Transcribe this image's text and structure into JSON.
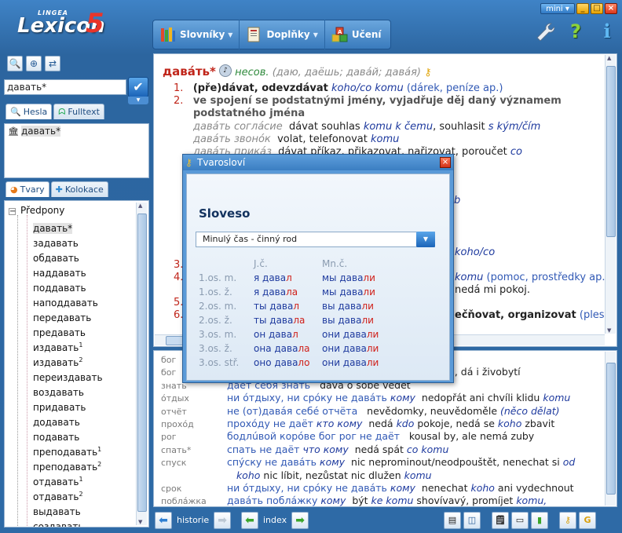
{
  "app": {
    "logo_small": "LINGEA",
    "logo_name": "Lexicon",
    "logo_version": "5",
    "mini_label": "mini",
    "window_buttons": [
      "_",
      "□",
      "×"
    ]
  },
  "menu": {
    "items": [
      {
        "label": "Slovníky",
        "icon": "books-icon",
        "has_dropdown": true
      },
      {
        "label": "Doplňky",
        "icon": "add-ons-icon",
        "has_dropdown": true
      },
      {
        "label": "Učení",
        "icon": "abc-blocks-icon",
        "has_dropdown": false
      }
    ],
    "tools": [
      {
        "icon": "wrench-icon",
        "glyph": "🔧"
      },
      {
        "icon": "help-icon",
        "glyph": "?"
      },
      {
        "icon": "info-icon",
        "glyph": "i"
      }
    ]
  },
  "search": {
    "value": "давать*",
    "go_label": "✔"
  },
  "tabs_top": [
    {
      "label": "Hesla",
      "icon": "magnifier-icon"
    },
    {
      "label": "Fulltext",
      "icon": "binoculars-icon"
    }
  ],
  "hesla_list": [
    {
      "text": "давать*"
    }
  ],
  "tabs_bottom": [
    {
      "label": "Tvary",
      "icon": "pie-icon"
    },
    {
      "label": "Kolokace",
      "icon": "puzzle-icon"
    }
  ],
  "tree": {
    "root": "Předpony",
    "items": [
      {
        "text": "давать*",
        "sup": ""
      },
      {
        "text": "задавать",
        "sup": ""
      },
      {
        "text": "обдавать",
        "sup": ""
      },
      {
        "text": "наддавать",
        "sup": ""
      },
      {
        "text": "поддавать",
        "sup": ""
      },
      {
        "text": "наподдавать",
        "sup": ""
      },
      {
        "text": "передавать",
        "sup": ""
      },
      {
        "text": "предавать",
        "sup": ""
      },
      {
        "text": "издавать",
        "sup": "1"
      },
      {
        "text": "издавать",
        "sup": "2"
      },
      {
        "text": "переиздавать",
        "sup": ""
      },
      {
        "text": "воздавать",
        "sup": ""
      },
      {
        "text": "придавать",
        "sup": ""
      },
      {
        "text": "додавать",
        "sup": ""
      },
      {
        "text": "подавать",
        "sup": ""
      },
      {
        "text": "преподавать",
        "sup": "1"
      },
      {
        "text": "преподавать",
        "sup": "2"
      },
      {
        "text": "отдавать",
        "sup": "1"
      },
      {
        "text": "отдавать",
        "sup": "2"
      },
      {
        "text": "выдавать",
        "sup": ""
      },
      {
        "text": "создавать",
        "sup": ""
      }
    ]
  },
  "entry": {
    "headword": "давáть*",
    "aspect": "несов.",
    "forms": "(даю, даёшь; давáй; давáя)",
    "senses": [
      {
        "num": "1.",
        "bold": "(pře)dávat, odevzdávat",
        "obj": "koho/co komu",
        "note": "(dárek, peníze ap.)"
      },
      {
        "num": "2.",
        "bold": "ve spojení se podstatnými jmény, vyjadřuje děj daný významem",
        "bold2": "podstatného jména"
      }
    ],
    "examples": [
      {
        "ru": "давáть соглáсие",
        "cz": "dávat souhlas",
        "obj": "komu k čemu",
        "cz2": ", souhlasit",
        "obj2": "s kým/čím"
      },
      {
        "ru": "давáть звонóк",
        "cz": "volat, telefonovat",
        "obj": "komu",
        "cz2": "",
        "obj2": ""
      },
      {
        "ru": "давáть прикáз",
        "cz": "dávat příkaz, přikazovat, nařizovat, poroučet",
        "obj": "co",
        "cz2": "",
        "obj2": ""
      }
    ],
    "right_fragments": [
      {
        "text": "koho/co"
      },
      {
        "text": "komu",
        "rest": " (pomoc, prostředky ap.)"
      },
      {
        "text": "nedá mi pokoj."
      },
      {
        "text": "ečňovat, organizovat",
        "rest": " (ples,"
      }
    ],
    "hidden_nums": [
      "3.",
      "4.",
      "5.",
      "6."
    ],
    "hidden_partial": [
      "b"
    ]
  },
  "collocations": [
    {
      "key": "бог",
      "ru": "",
      "cz": ""
    },
    {
      "key": "бог",
      "ru": "",
      "cz": "n, dá i živobytí"
    },
    {
      "key": "знать",
      "ru": "даёт себя знать",
      "cz": "dává o sobě vědět"
    },
    {
      "key": "óтдых",
      "ru": "ни óтдыху, ни срóку не давáть",
      "ru_obj": "кому",
      "cz": "nedopřát ani chvíli klidu",
      "cz_obj": "komu"
    },
    {
      "key": "отчёт",
      "ru": "не (от)давáя себé отчёта",
      "cz": "nevědomky, neuvědoměle",
      "cz_obj": "(něco dělat)"
    },
    {
      "key": "прохóд",
      "ru": "прохóду не даёт",
      "ru_obj": "кто кому",
      "cz": "nedá",
      "cz_obj": "kdo",
      "cz_rest": "pokoje, nedá se",
      "cz_obj2": "koho",
      "cz_rest2": "zbavit"
    },
    {
      "key": "рог",
      "ru": "бодлúвой корóве бог рог не даёт",
      "cz": "kousal by, ale nemá zuby"
    },
    {
      "key": "спать*",
      "ru": "спать не даёт",
      "ru_obj": "что кому",
      "cz": "nedá spát",
      "cz_obj": "co komu"
    },
    {
      "key": "спуск",
      "ru": "спýску не давáть",
      "ru_obj": "кому",
      "cz": "nic neprominout/neodpouštět, nenechat si",
      "cz_obj": "od"
    },
    {
      "key": "",
      "ru": "",
      "cz": "",
      "cz_obj": "koho",
      "cz_rest": "nic líbit, nezůstat nic dlužen",
      "cz_obj2": "komu"
    },
    {
      "key": "срок",
      "ru": "ни óтдыху, ни срóку не давáть",
      "ru_obj": "кому",
      "cz": "nenechat",
      "cz_obj": "koho",
      "cz_rest": "ani vydechnout"
    },
    {
      "key": "поблáжка",
      "ru": "давáть поблáжку",
      "ru_obj": "кому",
      "cz": "být",
      "cz_obj": "ke komu",
      "cz_rest": "shovívavý, promíjet",
      "cz_obj2": "komu,"
    }
  ],
  "dialog": {
    "title": "Tvarosloví",
    "pos": "Sloveso",
    "selected_form": "Minulý čas - činný rod",
    "col_sg": "J.č.",
    "col_pl": "Mn.č.",
    "rows": [
      {
        "person": "1.os. m.",
        "sg_pron": "я дава",
        "sg_end": "л",
        "pl_pron": "мы дава",
        "pl_end": "ли"
      },
      {
        "person": "1.os. ž.",
        "sg_pron": "я дава",
        "sg_end": "ла",
        "pl_pron": "мы дава",
        "pl_end": "ли"
      },
      {
        "person": "2.os. m.",
        "sg_pron": "ты дава",
        "sg_end": "л",
        "pl_pron": "вы дава",
        "pl_end": "ли"
      },
      {
        "person": "2.os. ž.",
        "sg_pron": "ты дава",
        "sg_end": "ла",
        "pl_pron": "вы дава",
        "pl_end": "ли"
      },
      {
        "person": "3.os. m.",
        "sg_pron": "он дава",
        "sg_end": "л",
        "pl_pron": "они дава",
        "pl_end": "ли"
      },
      {
        "person": "3.os. ž.",
        "sg_pron": "она дава",
        "sg_end": "ла",
        "pl_pron": "они дава",
        "pl_end": "ли"
      },
      {
        "person": "3.os. stř.",
        "sg_pron": "оно дава",
        "sg_end": "ло",
        "pl_pron": "они дава",
        "pl_end": "ли"
      }
    ]
  },
  "bottom": {
    "history_label": "historie",
    "index_label": "index"
  },
  "colors": {
    "accent": "#2e6aa6",
    "headword": "#c0251a",
    "link": "#1e3a9e"
  }
}
